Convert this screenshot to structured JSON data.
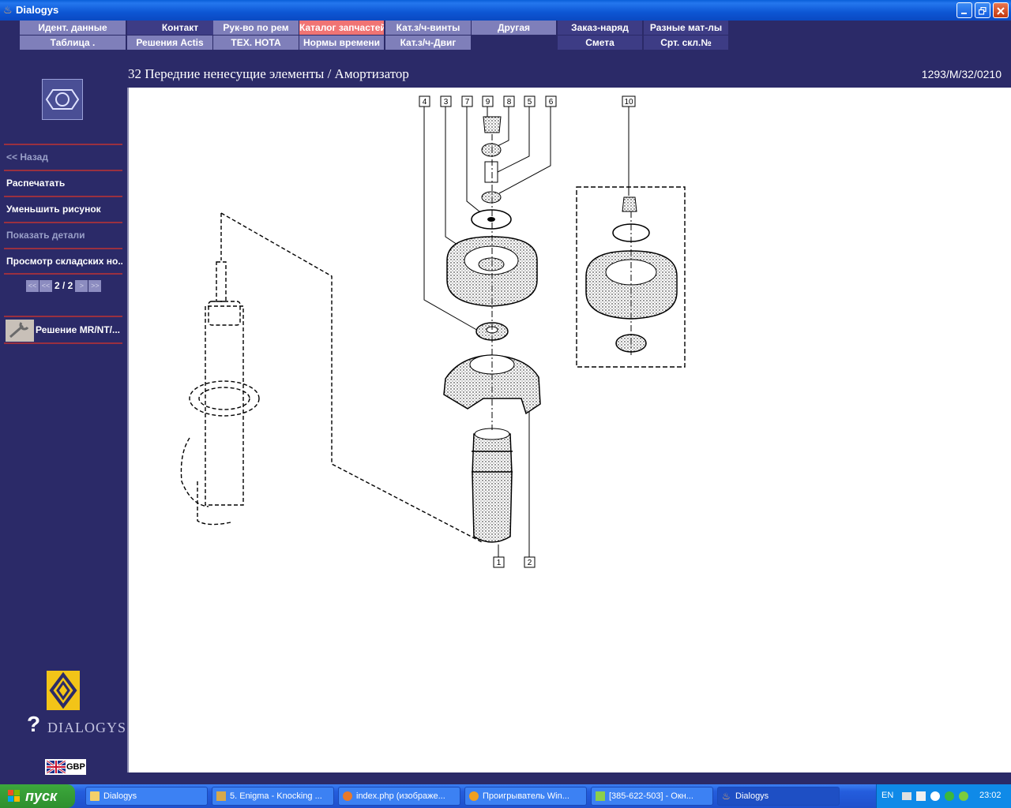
{
  "window": {
    "title": "Dialogys",
    "app_icon": "java-cup-icon",
    "controls": [
      "minimize",
      "restore",
      "close"
    ]
  },
  "menu": {
    "row1": [
      {
        "label": "Идент. данные"
      },
      {
        "label": "Контакт"
      },
      {
        "label": "Рук-во по рем"
      },
      {
        "label": "Каталог запчастей",
        "selected": true
      },
      {
        "label": "Кат.з/ч-винты"
      },
      {
        "label": "Другая"
      },
      {
        "label": "Заказ-наряд"
      },
      {
        "label": "Разные мат-лы"
      }
    ],
    "row2": [
      {
        "label": "Таблица ."
      },
      {
        "label": "Решения Actis"
      },
      {
        "label": "ТЕХ. НОТА"
      },
      {
        "label": "Нормы времени"
      },
      {
        "label": "Кат.з/ч-Двиг"
      },
      {
        "label": ""
      },
      {
        "label": "Смета"
      },
      {
        "label": "Срт. скл.№"
      }
    ]
  },
  "sidebar": {
    "items": [
      {
        "label": "<< Назад",
        "disabled": true
      },
      {
        "label": "Распечатать",
        "disabled": false
      },
      {
        "label": "Уменьшить рисунок",
        "disabled": false
      },
      {
        "label": "Показать детали",
        "disabled": true
      },
      {
        "label": "Просмотр складских но...",
        "disabled": false
      }
    ],
    "pager": {
      "first": "<<",
      "prev": "<<",
      "text": "2 / 2",
      "next": ">",
      "last": ">>"
    },
    "solution_label": "Решение MR/NT/...",
    "brand_logo": "DIALOGYS",
    "lang_code": "GBP"
  },
  "header": {
    "title": "32 Передние ненесущие элементы / Амортизатор",
    "code": "1293/M/32/0210"
  },
  "diagram": {
    "callouts_top": [
      "4",
      "3",
      "7",
      "9",
      "8",
      "5",
      "6",
      "10"
    ],
    "callouts_bottom": [
      "1",
      "2"
    ]
  },
  "taskbar": {
    "start_label": "пуск",
    "tasks": [
      {
        "label": "Dialogys",
        "icon": "folder-icon"
      },
      {
        "label": "5. Enigma - Knocking ...",
        "icon": "winamp-icon"
      },
      {
        "label": "index.php (изображе...",
        "icon": "firefox-icon"
      },
      {
        "label": "Проигрыватель Win...",
        "icon": "media-player-icon"
      },
      {
        "label": "[385-622-503] - Окн...",
        "icon": "icq-icon"
      },
      {
        "label": "Dialogys",
        "icon": "java-cup-icon",
        "active": true
      }
    ],
    "tray": {
      "lang": "EN",
      "time": "23:02"
    }
  }
}
